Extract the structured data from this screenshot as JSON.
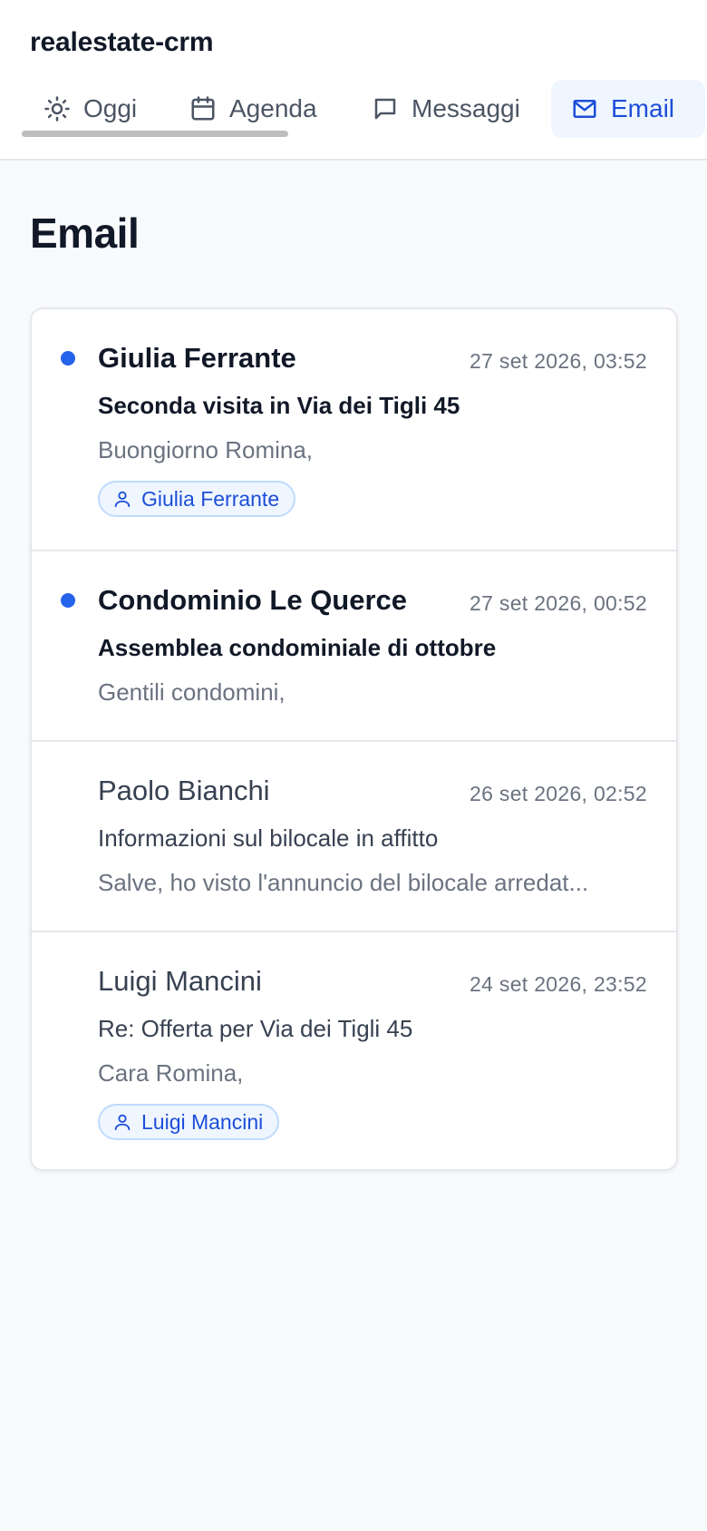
{
  "app": {
    "title": "realestate-crm"
  },
  "nav": {
    "tabs": [
      {
        "label": "Oggi",
        "icon": "sun-icon",
        "active": false
      },
      {
        "label": "Agenda",
        "icon": "calendar-icon",
        "active": false
      },
      {
        "label": "Messaggi",
        "icon": "message-icon",
        "active": false
      },
      {
        "label": "Email",
        "icon": "mail-icon",
        "active": true
      }
    ]
  },
  "page": {
    "title": "Email"
  },
  "emails": [
    {
      "sender": "Giulia Ferrante",
      "date": "27 set 2026, 03:52",
      "subject": "Seconda visita in Via dei Tigli 45",
      "preview": "Buongiorno Romina,",
      "contact": "Giulia Ferrante",
      "unread": true
    },
    {
      "sender": "Condominio Le Querce",
      "date": "27 set 2026, 00:52",
      "subject": "Assemblea condominiale di ottobre",
      "preview": "Gentili condomini,",
      "contact": null,
      "unread": true
    },
    {
      "sender": "Paolo Bianchi",
      "date": "26 set 2026, 02:52",
      "subject": "Informazioni sul bilocale in affitto",
      "preview": "Salve, ho visto l'annuncio del bilocale arredat...",
      "contact": null,
      "unread": false
    },
    {
      "sender": "Luigi Mancini",
      "date": "24 set 2026, 23:52",
      "subject": "Re: Offerta per Via dei Tigli 45",
      "preview": "Cara Romina,",
      "contact": "Luigi Mancini",
      "unread": false
    }
  ],
  "colors": {
    "accent": "#1d4ed8",
    "unread_dot": "#2563eb",
    "chip_bg": "#eff6ff",
    "page_bg": "#f8fafc"
  }
}
